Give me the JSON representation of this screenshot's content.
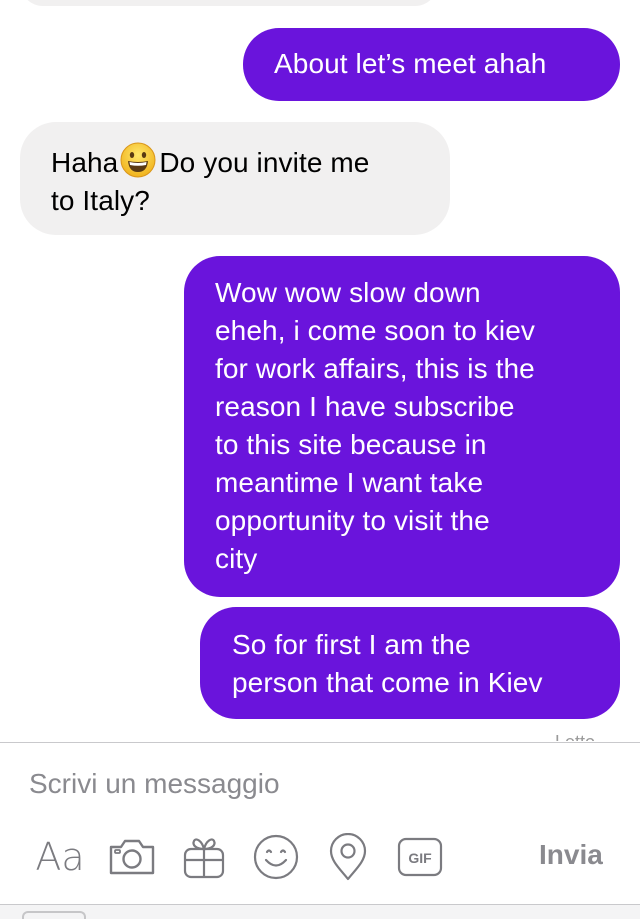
{
  "conversation": {
    "messages": [
      {
        "direction": "outgoing",
        "text": "About let’s meet ahah"
      },
      {
        "direction": "incoming",
        "text_before": "Haha",
        "emoji": "grinning-face-emoji",
        "text_after": "Do you invite me\nto Italy?"
      },
      {
        "direction": "outgoing",
        "text": "Wow wow slow down\neheh, i come soon to kiev\nfor work affairs, this is the\nreason I have subscribe\nto this site because in\nmeantime I want take\nopportunity to visit the\ncity"
      },
      {
        "direction": "outgoing",
        "text": "So for first I am the\nperson that come in Kiev"
      }
    ],
    "status_text": "Letto"
  },
  "composer": {
    "placeholder": "Scrivi un messaggio",
    "send_label": "Invia",
    "aa_label": "Aa",
    "gif_label": "GIF",
    "icons": [
      "text-format-icon",
      "camera-icon",
      "gift-icon",
      "emoji-icon",
      "location-pin-icon",
      "gif-icon"
    ]
  },
  "colors": {
    "outgoing_bubble": "#6a14dc",
    "incoming_bubble": "#f1f0f0",
    "toolbar_icon": "#7b7b80",
    "placeholder": "#8a8a8f"
  }
}
